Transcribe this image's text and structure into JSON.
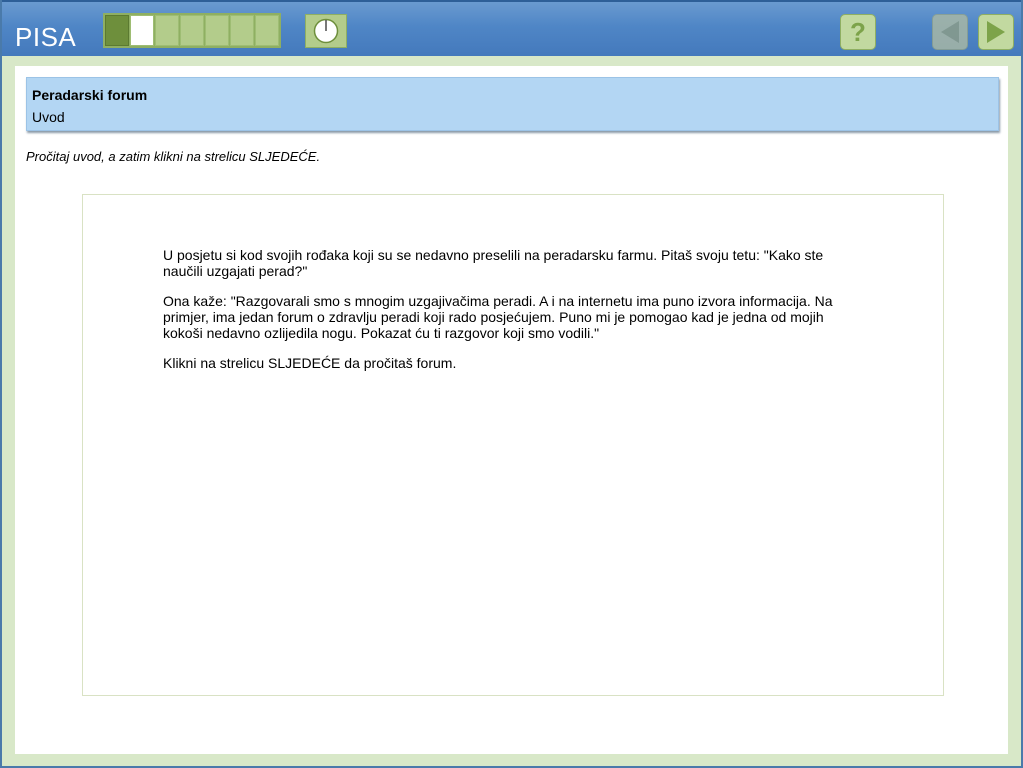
{
  "header": {
    "logo": "PISA",
    "progress": {
      "total": 7,
      "done": 1,
      "current": 2
    }
  },
  "icons": {
    "timer": "clock-icon",
    "help": "question-mark-icon",
    "back": "triangle-left-icon",
    "next": "triangle-right-icon"
  },
  "unit": {
    "title": "Peradarski forum",
    "subtitle": "Uvod"
  },
  "instruction": "Pročitaj uvod, a zatim klikni na strelicu SLJEDEĆE.",
  "stimulus": {
    "paragraphs": [
      "U posjetu si kod svojih rođaka koji su se nedavno preselili na peradarsku farmu. Pitaš svoju tetu: \"Kako ste naučili uzgajati perad?\"",
      "Ona kaže: \"Razgovarali smo s mnogim uzgajivačima peradi. A i na internetu ima puno izvora informacija. Na primjer, ima jedan forum o zdravlju peradi koji rado posjećujem. Puno mi je pomogao kad je jedna od mojih kokoši nedavno ozlijedila nogu. Pokazat ću ti razgovor koji smo vodili.\"",
      "Klikni na strelicu SLJEDEĆE da pročitaš forum."
    ]
  },
  "colors": {
    "topbar": "#4f86c6",
    "frame": "#d8e8c8",
    "header_bg": "#b3d6f3",
    "button_green": "#c2d9a0",
    "progress_done": "#6e8f3c"
  }
}
